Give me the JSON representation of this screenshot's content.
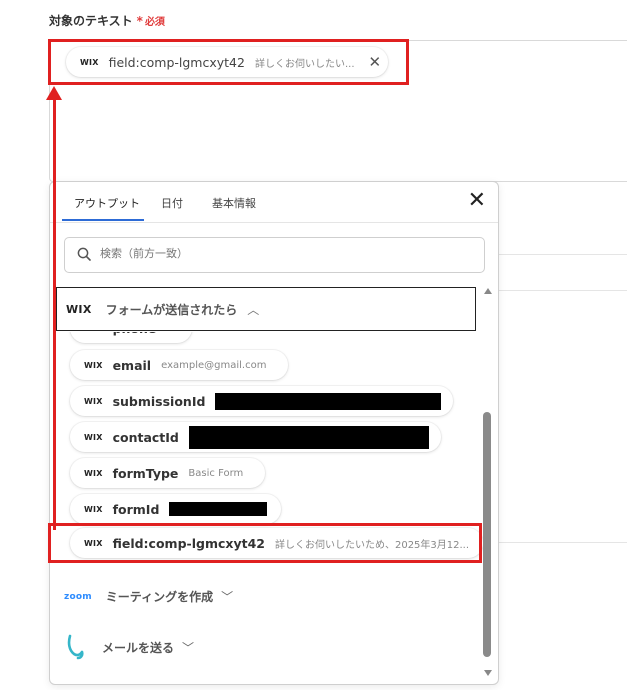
{
  "field": {
    "label": "対象のテキスト",
    "required_star": "*",
    "required_text": "必須"
  },
  "top_chip": {
    "service": "WIX",
    "name": "field:comp-lgmcxyt42",
    "value": "詳しくお伺いしたい..."
  },
  "panel": {
    "tabs": [
      "アウトプット",
      "日付",
      "基本情報"
    ],
    "active_tab": "アウトプット",
    "search_placeholder": "検索（前方一致）",
    "group": {
      "service": "WIX",
      "title": "フォームが送信されたら"
    },
    "items": [
      {
        "name": "phone",
        "value": ""
      },
      {
        "name": "email",
        "value": "example@gmail.com"
      },
      {
        "name": "submissionId",
        "value": ""
      },
      {
        "name": "contactId",
        "value": ""
      },
      {
        "name": "formType",
        "value": "Basic Form"
      },
      {
        "name": "formId",
        "value": ""
      },
      {
        "name": "field:comp-lgmcxyt42",
        "value": "詳しくお伺いしたいため、2025年3月12..."
      }
    ],
    "sections": [
      {
        "logo": "zoom",
        "title": "ミーティングを作成"
      },
      {
        "logo": "mail-logo-icon",
        "title": "メールを送る"
      }
    ]
  },
  "colors": {
    "highlight_red": "#e02020",
    "tab_accent": "#2d6bd6",
    "required_red": "#e03c3c",
    "zoom_blue": "#2d8cff",
    "mail_logo_teal": "#35b6c9"
  }
}
